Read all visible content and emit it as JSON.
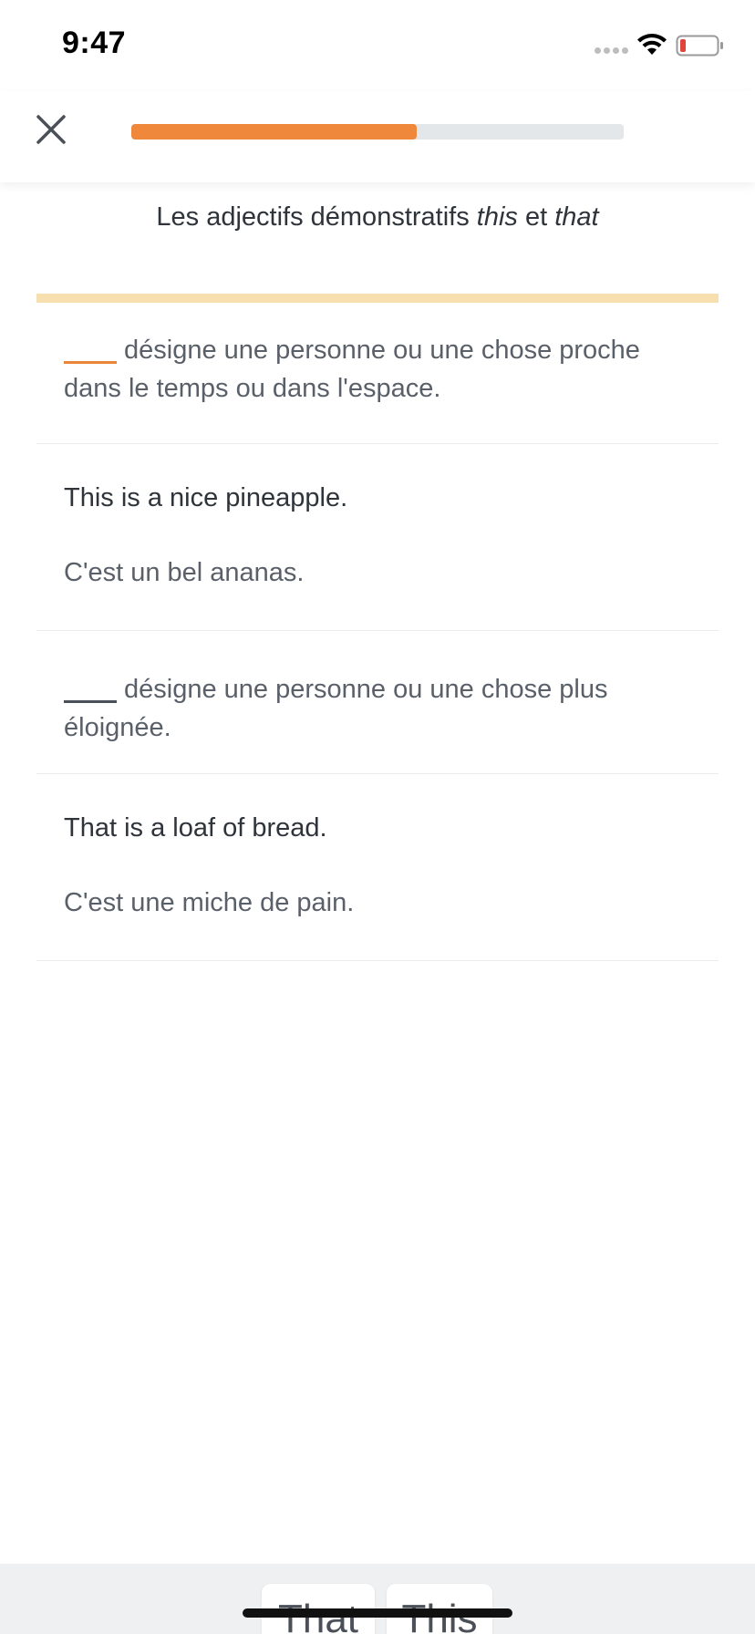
{
  "status_bar": {
    "time": "9:47",
    "icons": [
      "signal-dots-icon",
      "wifi-icon",
      "battery-low-icon"
    ]
  },
  "header": {
    "close_icon": "close-icon",
    "progress_fraction": 0.58,
    "progress_color": "#f0883b",
    "track_color": "#e4e7ea"
  },
  "lesson": {
    "title_prefix": "Les adjectifs démonstratifs ",
    "title_word1": "this",
    "title_middle": " et ",
    "title_word2": "that",
    "accent_color": "#f8dfb0"
  },
  "cards": {
    "rule1": {
      "text": "désigne une personne ou une chose proche dans le temps ou dans l'espace.",
      "blank_state": "active"
    },
    "example1": {
      "en": "This is a nice pineapple.",
      "fr": "C'est un bel ananas."
    },
    "rule2": {
      "text": "désigne une personne ou une chose plus éloignée.",
      "blank_state": "empty"
    },
    "example2": {
      "en": "That is a loaf of bread.",
      "fr": "C'est une miche de pain."
    }
  },
  "answer_tray": {
    "choices": [
      "That",
      "This"
    ]
  },
  "colors": {
    "active_blank": "#e8853b",
    "body_text": "#2f343b",
    "muted_text": "#5a6069"
  }
}
